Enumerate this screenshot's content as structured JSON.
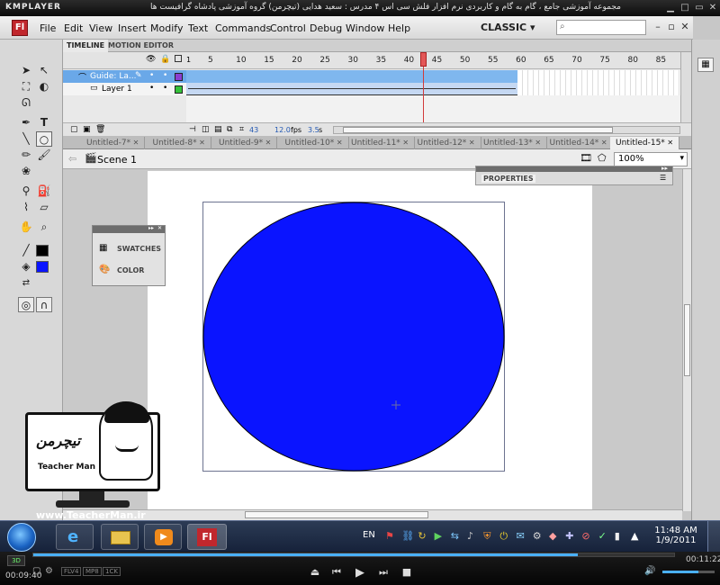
{
  "player": {
    "logo": "KMPLAYER",
    "title": "مجموعه آموزشی جامع ، گام به گام و کاربردی نرم افزار فلش سی اس ۴ مدرس : سعید هدایی (تیچرمن) گروه آموزشی پادشاه گرافیست ها",
    "elapsed": "00:09:40",
    "total": "00:11:22",
    "progress": 0.85,
    "format_badges": [
      "FLV4",
      "MP8",
      "1CK"
    ]
  },
  "menubar": {
    "logo": "Fl",
    "items": [
      "File",
      "Edit",
      "View",
      "Insert",
      "Modify",
      "Text",
      "Commands",
      "Control",
      "Debug",
      "Window",
      "Help"
    ],
    "workspace": "CLASSIC"
  },
  "timeline": {
    "tabs": [
      "TIMELINE",
      "MOTION EDITOR"
    ],
    "frame_numbers": [
      "5",
      "10",
      "15",
      "20",
      "25",
      "30",
      "35",
      "40",
      "45",
      "50",
      "55",
      "60",
      "65",
      "70",
      "75",
      "80",
      "85"
    ],
    "current_frame": 43,
    "layers": [
      {
        "name": "Guide: La...",
        "color": "#8b3fd1",
        "selected": true
      },
      {
        "name": "Layer 1",
        "color": "#35c23a",
        "selected": false
      }
    ],
    "footer": {
      "frame": "43",
      "fps": "12.0",
      "fps_label": "fps",
      "time": "3.5",
      "time_label": "s"
    }
  },
  "doc_tabs": {
    "tabs": [
      "Untitled-7*",
      "Untitled-8*",
      "Untitled-9*",
      "Untitled-10*",
      "Untitled-11*",
      "Untitled-12*",
      "Untitled-13*",
      "Untitled-14*",
      "Untitled-15*"
    ],
    "active_index": 8
  },
  "scene": {
    "name": "Scene 1",
    "zoom": "100%"
  },
  "panels": {
    "properties": "PROPERTIES",
    "swatches": "SWATCHES",
    "color": "COLOR"
  },
  "stage": {
    "shape": "circle",
    "fill": "#0a14ff",
    "stroke": "#000000"
  },
  "colors": {
    "stroke_swatch": "#000000",
    "fill_swatch": "#0a14ff",
    "accent_red": "#c1272d"
  },
  "watermark": {
    "site": "www.TeacherMan.ir",
    "name": "Teacher Man"
  },
  "taskbar": {
    "lang": "EN",
    "time": "11:48 AM",
    "date": "1/9/2011",
    "apps": [
      "ie-icon",
      "explorer-icon",
      "media-icon",
      "flash-icon"
    ]
  }
}
